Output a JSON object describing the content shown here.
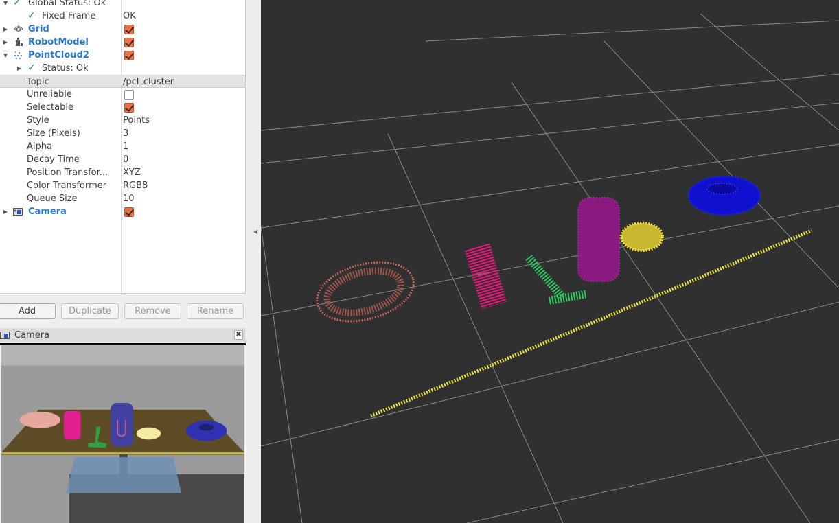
{
  "tree": {
    "global_status": "Global Status: Ok",
    "fixed_frame": {
      "label": "Fixed Frame",
      "value": "OK"
    },
    "displays": [
      {
        "label": "Grid",
        "checked": true,
        "icon": "grid-icon"
      },
      {
        "label": "RobotModel",
        "checked": true,
        "icon": "robot-model-icon"
      },
      {
        "label": "PointCloud2",
        "checked": true,
        "icon": "point-cloud-icon"
      }
    ],
    "pc_status": "Status: Ok",
    "properties": [
      {
        "label": "Topic",
        "value": "/pcl_cluster"
      },
      {
        "label": "Unreliable",
        "checkbox": false
      },
      {
        "label": "Selectable",
        "checkbox": true
      },
      {
        "label": "Style",
        "value": "Points"
      },
      {
        "label": "Size (Pixels)",
        "value": "3"
      },
      {
        "label": "Alpha",
        "value": "1"
      },
      {
        "label": "Decay Time",
        "value": "0"
      },
      {
        "label": "Position Transfor...",
        "value": "XYZ"
      },
      {
        "label": "Color Transformer",
        "value": "RGB8"
      },
      {
        "label": "Queue Size",
        "value": "10"
      }
    ],
    "camera": {
      "label": "Camera",
      "checked": true
    }
  },
  "buttons": {
    "add": "Add",
    "duplicate": "Duplicate",
    "remove": "Remove",
    "rename": "Rename"
  },
  "camera_panel": {
    "title": "Camera"
  },
  "colors": {
    "checkbox": "#e9744a",
    "display_name": "#2a7ad2",
    "view_bg": "#303030",
    "cloud_salmon": "#c8645a",
    "cloud_pink": "#f0147e",
    "cloud_green": "#2ec860",
    "cloud_purple": "#8a1a80",
    "cloud_yellow": "#f0e040",
    "cloud_blue": "#1010d0"
  }
}
